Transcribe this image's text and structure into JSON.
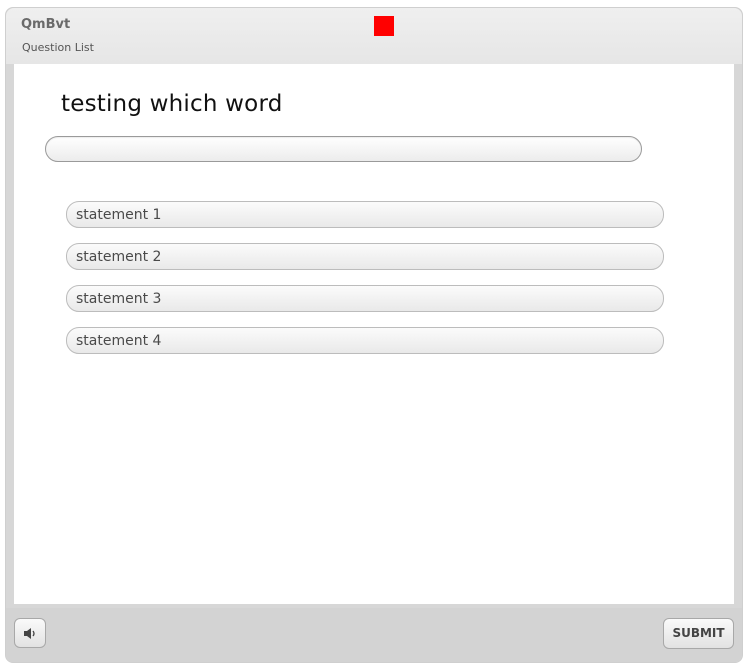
{
  "header": {
    "title": "QmBvt",
    "subtitle": "Question List",
    "indicator_color": "#ff0000"
  },
  "question": {
    "title": "testing which word",
    "answer_value": ""
  },
  "statements": [
    {
      "label": "statement 1"
    },
    {
      "label": "statement 2"
    },
    {
      "label": "statement 3"
    },
    {
      "label": "statement 4"
    }
  ],
  "footer": {
    "sound_icon": "speaker-icon",
    "submit_label": "SUBMIT"
  }
}
